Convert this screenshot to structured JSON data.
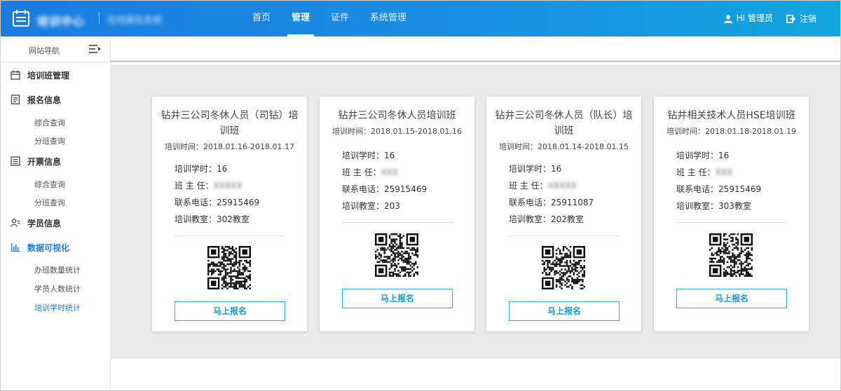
{
  "header": {
    "brand": "培训中心",
    "brand_sub": "在线报名系统",
    "nav": [
      {
        "label": "首页",
        "active": false
      },
      {
        "label": "管理",
        "active": true
      },
      {
        "label": "证件",
        "active": false
      },
      {
        "label": "系统管理",
        "active": false
      }
    ],
    "user_label": "HI 管理员",
    "logout_label": "注销"
  },
  "sidebar": {
    "title": "网站导航",
    "groups": [
      {
        "label": "培训班管理",
        "icon": "calendar-icon",
        "subs": []
      },
      {
        "label": "报名信息",
        "icon": "document-icon",
        "subs": [
          "综合查询",
          "分班查询"
        ]
      },
      {
        "label": "开票信息",
        "icon": "list-icon",
        "subs": [
          "综合查询",
          "分班查询"
        ]
      },
      {
        "label": "学员信息",
        "icon": "user-group-icon",
        "subs": []
      },
      {
        "label": "数据可视化",
        "icon": "bar-chart-icon",
        "subs": [
          "办班数量统计",
          "学员人数统计",
          "培训学时统计"
        ],
        "active": true,
        "active_sub": 2
      }
    ]
  },
  "cards": [
    {
      "title": "钻井三公司冬休人员（司钻）培训班",
      "date": "培训时间：2018.01.16-2018.01.17",
      "hours_label": "培训学时：",
      "hours": "16",
      "teacher_label": "班 主 任：",
      "teacher": "XXXXX",
      "phone_label": "联系电话：",
      "phone": "25915469",
      "room_label": "培训教室：",
      "room": "302教室",
      "button": "马上报名"
    },
    {
      "title": "钻井三公司冬休人员培训班",
      "date": "培训时间：2018.01.15-2018.01.16",
      "hours_label": "培训学时：",
      "hours": "16",
      "teacher_label": "班 主 任：",
      "teacher": "XXX",
      "phone_label": "联系电话：",
      "phone": "25915469",
      "room_label": "培训教室：",
      "room": "203",
      "button": "马上报名"
    },
    {
      "title": "钻井三公司冬休人员（队长）培训班",
      "date": "培训时间：2018.01.14-2018.01.15",
      "hours_label": "培训学时：",
      "hours": "16",
      "teacher_label": "班 主 任：",
      "teacher": "XXXXX",
      "phone_label": "联系电话：",
      "phone": "25911087",
      "room_label": "培训教室：",
      "room": "202教室",
      "button": "马上报名"
    },
    {
      "title": "钻井相关技术人员HSE培训班",
      "date": "培训时间：2018.01.18-2018.01.19",
      "hours_label": "培训学时：",
      "hours": "16",
      "teacher_label": "班 主 任：",
      "teacher": "XXX",
      "phone_label": "联系电话：",
      "phone": "25915469",
      "room_label": "培训教室：",
      "room": "303教室",
      "button": "马上报名"
    }
  ],
  "colors": {
    "accent": "#1a7ce0",
    "button_border": "#1fb8d8",
    "background": "#ebebeb"
  }
}
